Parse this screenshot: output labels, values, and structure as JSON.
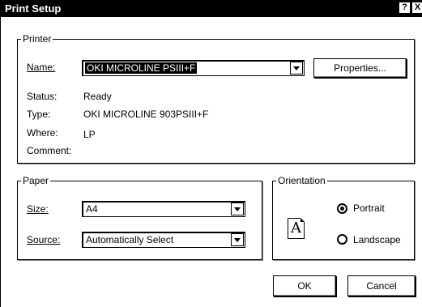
{
  "window": {
    "title": "Print Setup",
    "help_glyph": "?",
    "close_glyph": "X"
  },
  "printer": {
    "group_label": "Printer",
    "name_label": "Name:",
    "name_value": "OKI MICROLINE PSIII+F",
    "properties_button": "Properties...",
    "status_label": "Status:",
    "status_value": "Ready",
    "type_label": "Type:",
    "type_value": "OKI MICROLINE 903PSIII+F",
    "where_label": "Where:",
    "where_value": "LP",
    "comment_label": "Comment:",
    "comment_value": ""
  },
  "paper": {
    "group_label": "Paper",
    "size_label": "Size:",
    "size_value": "A4",
    "source_label": "Source:",
    "source_value": "Automatically Select"
  },
  "orientation": {
    "group_label": "Orientation",
    "icon_letter": "A",
    "portrait_label": "Portrait",
    "landscape_label": "Landscape",
    "selected": "Portrait"
  },
  "buttons": {
    "ok": "OK",
    "cancel": "Cancel"
  },
  "icons": {
    "help": "question-mark-icon",
    "close": "close-icon",
    "dropdown": "chevron-down-icon",
    "orientation": "page-orientation-icon"
  }
}
